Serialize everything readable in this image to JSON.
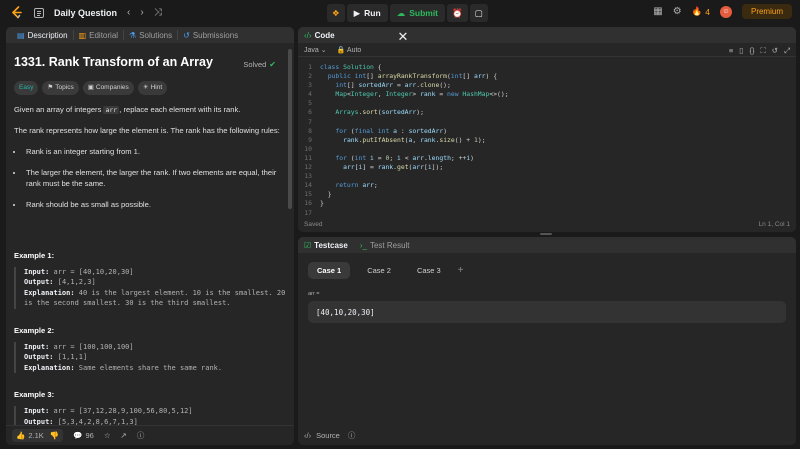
{
  "topbar": {
    "title": "Daily Question",
    "run_label": "Run",
    "submit_label": "Submit",
    "streak_count": "4",
    "premium_label": "Premium"
  },
  "left_tabs": [
    "Description",
    "Editorial",
    "Solutions",
    "Submissions"
  ],
  "problem": {
    "title": "1331. Rank Transform of an Array",
    "status": "Solved",
    "tags": [
      "Easy",
      "Topics",
      "Companies",
      "Hint"
    ],
    "desc_pre": "Given an array of integers ",
    "desc_code": "arr",
    "desc_post": ", replace each element with its rank.",
    "rules_intro": "The rank represents how large the element is. The rank has the following rules:",
    "rules": [
      "Rank is an integer starting from 1.",
      "The larger the element, the larger the rank. If two elements are equal, their rank must be the same.",
      "Rank should be as small as possible."
    ],
    "examples": [
      {
        "title": "Example 1:",
        "input": "arr = [40,10,20,30]",
        "output": "[4,1,2,3]",
        "explanation": "40 is the largest element. 10 is the smallest. 20 is the second smallest. 30 is the third smallest."
      },
      {
        "title": "Example 2:",
        "input": "arr = [100,100,100]",
        "output": "[1,1,1]",
        "explanation": "Same elements share the same rank."
      },
      {
        "title": "Example 3:",
        "input": "arr = [37,12,28,9,100,56,80,5,12]",
        "output": "[5,3,4,2,8,6,7,1,3]"
      }
    ],
    "labels": {
      "input": "Input:",
      "output": "Output:",
      "explanation": "Explanation:"
    },
    "likes": "2.1K",
    "comments": "96"
  },
  "code_panel": {
    "tab_label": "Code",
    "language": "Java",
    "auto_label": "Auto",
    "status_left": "Saved",
    "status_right": "Ln 1, Col 1",
    "line_numbers": [
      "1",
      "2",
      "3",
      "4",
      "5",
      "6",
      "7",
      "8",
      "9",
      "10",
      "11",
      "12",
      "13",
      "14",
      "15",
      "16",
      "17"
    ]
  },
  "test_panel": {
    "tabs": [
      "Testcase",
      "Test Result"
    ],
    "cases": [
      "Case 1",
      "Case 2",
      "Case 3"
    ],
    "arg_label": "arr =",
    "arg_value": "[40,10,20,30]",
    "source_label": "Source"
  }
}
